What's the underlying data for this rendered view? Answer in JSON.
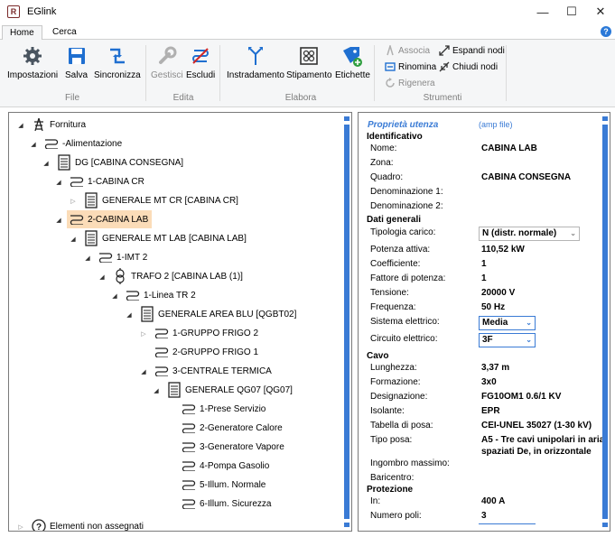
{
  "window": {
    "title": "EGlink",
    "app_icon": "R",
    "minimize": "—",
    "maximize": "☐",
    "close": "✕"
  },
  "tabs": [
    {
      "label": "Home"
    },
    {
      "label": "Cerca"
    }
  ],
  "help": "?",
  "ribbon": {
    "file": {
      "label": "File",
      "buttons": [
        "Impostazioni",
        "Salva",
        "Sincronizza"
      ]
    },
    "edita": {
      "label": "Edita",
      "buttons": [
        "Gestisci",
        "Escludi"
      ]
    },
    "elabora": {
      "label": "Elabora",
      "buttons": [
        "Instradamento",
        "Stipamento",
        "Etichette"
      ]
    },
    "strumenti": {
      "label": "Strumenti",
      "buttons": [
        "Associa",
        "Rinomina",
        "Rigenera",
        "Espandi nodi",
        "Chiudi nodi"
      ]
    }
  },
  "tree": [
    {
      "label": "Fornitura"
    },
    {
      "label": "-Alimentazione"
    },
    {
      "label": "DG [CABINA CONSEGNA]"
    },
    {
      "label": "1-CABINA CR"
    },
    {
      "label": "GENERALE MT CR [CABINA CR]"
    },
    {
      "label": "2-CABINA LAB"
    },
    {
      "label": "GENERALE MT LAB [CABINA LAB]"
    },
    {
      "label": "1-IMT 2"
    },
    {
      "label": "TRAFO 2 [CABINA LAB (1)]"
    },
    {
      "label": "1-Linea TR 2"
    },
    {
      "label": "GENERALE AREA BLU [QGBT02]"
    },
    {
      "label": "1-GRUPPO FRIGO 2"
    },
    {
      "label": "2-GRUPPO FRIGO 1"
    },
    {
      "label": "3-CENTRALE TERMICA"
    },
    {
      "label": "GENERALE QG07 [QG07]"
    },
    {
      "label": "1-Prese Servizio"
    },
    {
      "label": "2-Generatore Calore"
    },
    {
      "label": "3-Generatore Vapore"
    },
    {
      "label": "4-Pompa Gasolio"
    },
    {
      "label": "5-Illum. Normale"
    },
    {
      "label": "6-Illum. Sicurezza"
    },
    {
      "label": "Elementi non assegnati"
    }
  ],
  "props": {
    "title": "Proprietà utenza",
    "sub": "(amp file)",
    "sections": [
      "Identificativo",
      "Dati generali",
      "Cavo",
      "Protezione"
    ],
    "rows": [
      {
        "label": "Nome:",
        "value": "CABINA LAB"
      },
      {
        "label": "Zona:",
        "value": ""
      },
      {
        "label": "Quadro:",
        "value": "CABINA CONSEGNA"
      },
      {
        "label": "Denominazione 1:",
        "value": ""
      },
      {
        "label": "Denominazione 2:",
        "value": ""
      },
      {
        "label": "Tipologia carico:",
        "value": "N (distr. normale)"
      },
      {
        "label": "Potenza attiva:",
        "value": "110,52 kW"
      },
      {
        "label": "Coefficiente:",
        "value": "1"
      },
      {
        "label": "Fattore di potenza:",
        "value": "1"
      },
      {
        "label": "Tensione:",
        "value": "20000 V"
      },
      {
        "label": "Frequenza:",
        "value": "50 Hz"
      },
      {
        "label": "Sistema elettrico:",
        "value": "Media"
      },
      {
        "label": "Circuito elettrico:",
        "value": "3F"
      },
      {
        "label": "Lunghezza:",
        "value": "3,37 m"
      },
      {
        "label": "Formazione:",
        "value": "3x0"
      },
      {
        "label": "Designazione:",
        "value": "FG10OM1 0.6/1 KV"
      },
      {
        "label": "Isolante:",
        "value": "EPR"
      },
      {
        "label": "Tabella di posa:",
        "value": "CEI-UNEL 35027 (1-30 kV)"
      },
      {
        "label": "Tipo posa:",
        "value": "A5 - Tre cavi unipolari in aria"
      },
      {
        "label": "",
        "value": "spaziati De, in orizzontale"
      },
      {
        "label": "Ingombro massimo:",
        "value": ""
      },
      {
        "label": "Baricentro:",
        "value": ""
      },
      {
        "label": "In:",
        "value": "400 A"
      },
      {
        "label": "Numero poli:",
        "value": "3"
      }
    ]
  },
  "colors": {
    "accent": "#3a7bd5",
    "selection": "#fbdcb8",
    "disabled": "#8a8a8a"
  }
}
